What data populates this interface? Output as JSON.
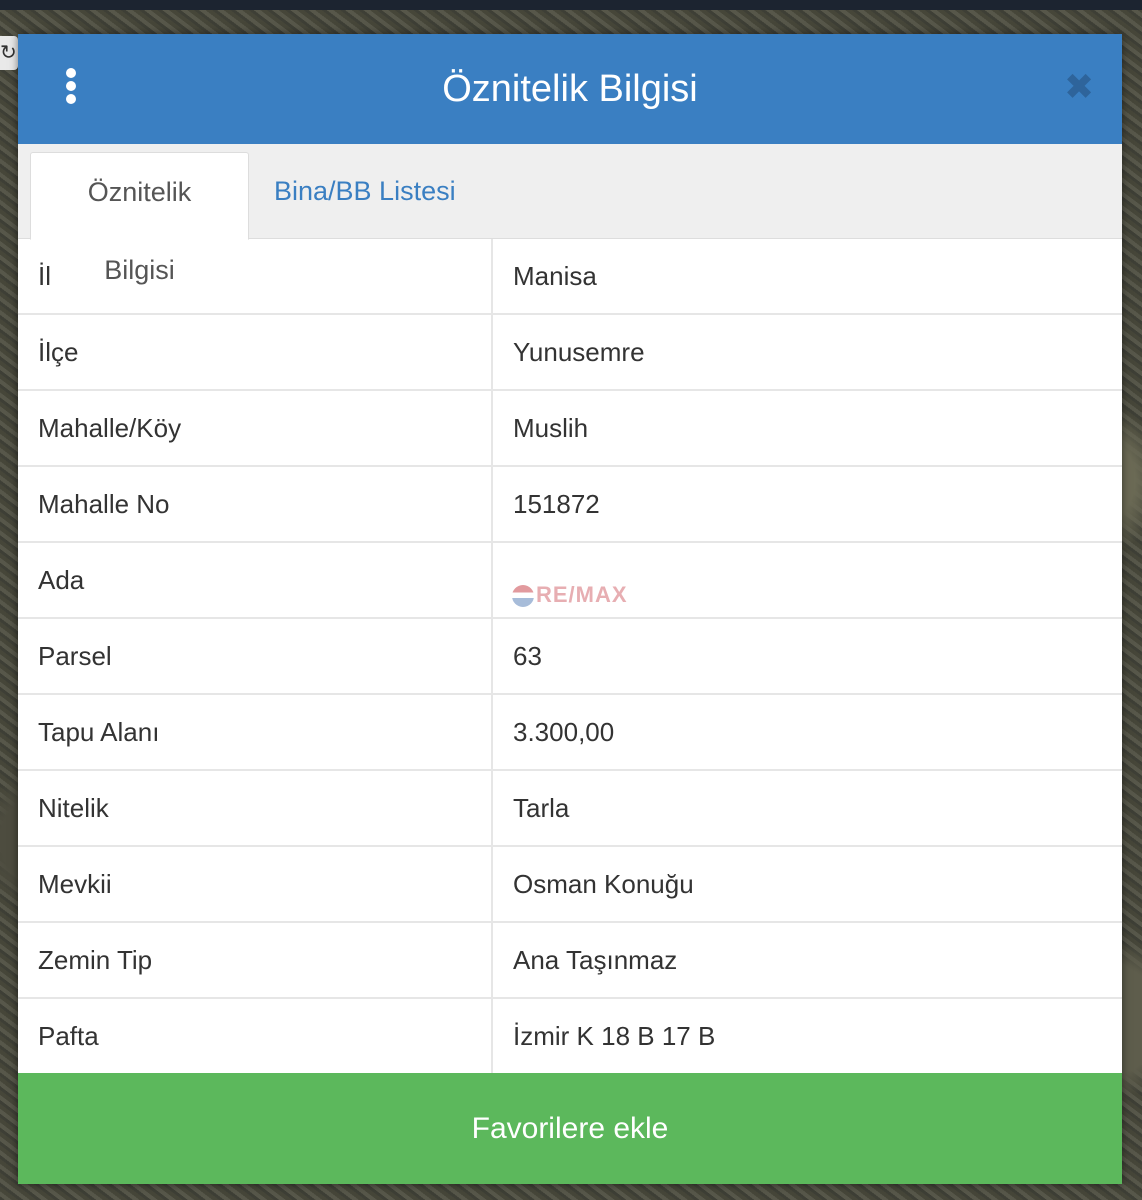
{
  "modal": {
    "title": "Öznitelik Bilgisi",
    "menu_icon": "vertical-ellipsis-icon",
    "close_icon": "close-x-icon"
  },
  "tabs": [
    {
      "label": "Öznitelik Bilgisi",
      "active": true
    },
    {
      "label": "Bina/BB Listesi",
      "active": false
    }
  ],
  "attributes": [
    {
      "label": "İl",
      "value": "Manisa"
    },
    {
      "label": "İlçe",
      "value": "Yunusemre"
    },
    {
      "label": "Mahalle/Köy",
      "value": "Muslih"
    },
    {
      "label": "Mahalle No",
      "value": "151872"
    },
    {
      "label": "Ada",
      "value": ""
    },
    {
      "label": "Parsel",
      "value": "63"
    },
    {
      "label": "Tapu Alanı",
      "value": "3.300,00"
    },
    {
      "label": "Nitelik",
      "value": "Tarla"
    },
    {
      "label": "Mevkii",
      "value": "Osman Konuğu"
    },
    {
      "label": "Zemin Tip",
      "value": "Ana Taşınmaz"
    },
    {
      "label": "Pafta",
      "value": "İzmir K 18 B 17 B"
    }
  ],
  "watermark": {
    "text": "RE/MAX"
  },
  "footer": {
    "favorite_label": "Favorilere ekle"
  },
  "colors": {
    "header": "#3a7fc2",
    "tab_link": "#3a7fc2",
    "favorite_button": "#5cb85c"
  }
}
